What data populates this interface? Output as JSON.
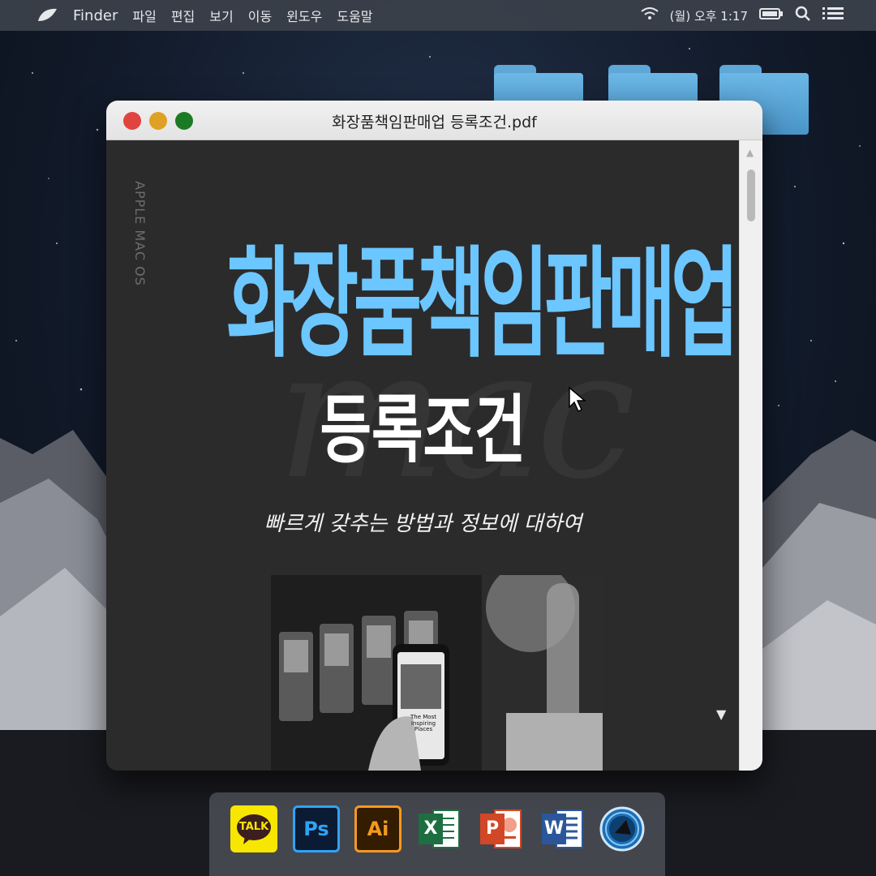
{
  "menubar": {
    "app_name": "Finder",
    "items": [
      "파일",
      "편집",
      "보기",
      "이동",
      "윈도우",
      "도움말"
    ],
    "clock": "(월) 오후 1:17"
  },
  "window": {
    "title": "화장품책임판매업 등록조건.pdf"
  },
  "document": {
    "vertical_label": "APPLE MAC OS",
    "watermark": "mac",
    "headline": "화장품책임판매업",
    "subheadline": "등록조건",
    "caption": "빠르게 갖추는 방법과 정보에 대하여",
    "photo_text": "The Most Inspiring Places"
  },
  "dock": {
    "kakao_label": "TALK",
    "ps_label": "Ps",
    "ai_label": "Ai",
    "excel_label": "X",
    "ppt_label": "P",
    "word_label": "W"
  },
  "colors": {
    "headline": "#6cc6ff",
    "menubar": "#3a404a",
    "close": "#e0443e",
    "minimize": "#dea123",
    "maximize": "#1b7a24"
  }
}
